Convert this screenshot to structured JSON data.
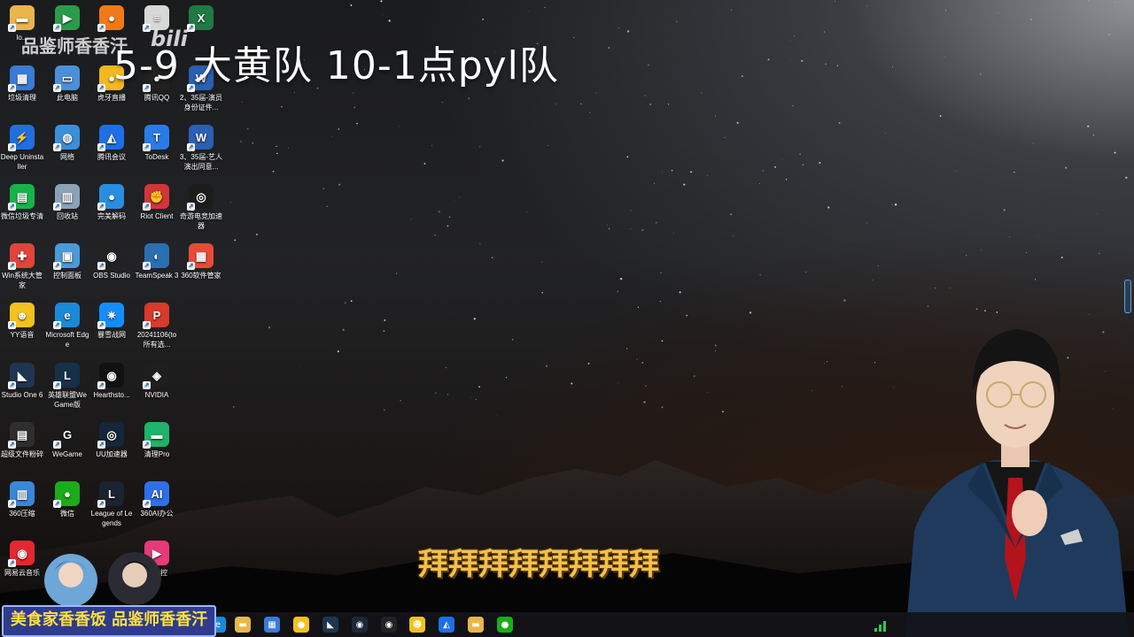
{
  "overlay": {
    "title": "5-9  大黄队  10-1点pyl队",
    "watermark": "品鉴师香香汗",
    "watermark_logo": "bili",
    "subtitle": "拜拜拜拜拜拜拜拜",
    "banner": "美食家香香饭 品鉴师香香汗"
  },
  "desktop_icons": [
    {
      "label": "lo...",
      "icon": "folder-icon",
      "color": "#e8b64a",
      "glyph": "▬"
    },
    {
      "label": "",
      "icon": "play-store-icon",
      "color": "#2b9b4a",
      "glyph": "▶"
    },
    {
      "label": "",
      "icon": "browser-orange-icon",
      "color": "#f07a1a",
      "glyph": "●"
    },
    {
      "label": "",
      "icon": "document-icon",
      "color": "#d8d8d8",
      "glyph": "≡"
    },
    {
      "label": "",
      "icon": "excel-icon",
      "color": "#1f7a43",
      "glyph": "X"
    },
    {
      "label": "垃圾清理",
      "icon": "cleaner-icon",
      "color": "#3a7bd5",
      "glyph": "▦"
    },
    {
      "label": "此电脑",
      "icon": "computer-icon",
      "color": "#4a90d9",
      "glyph": "▭"
    },
    {
      "label": "虎牙直播",
      "icon": "huya-icon",
      "color": "#f3b71f",
      "glyph": "●"
    },
    {
      "label": "腾讯QQ",
      "icon": "qq-icon",
      "color": "#222",
      "glyph": "●"
    },
    {
      "label": "2、35届-演员身份证件...",
      "icon": "word-icon",
      "color": "#2b5fb3",
      "glyph": "W"
    },
    {
      "label": "Deep Uninstaller",
      "icon": "deep-uninstaller-icon",
      "color": "#1f6fe0",
      "glyph": "⚡"
    },
    {
      "label": "网络",
      "icon": "network-icon",
      "color": "#3a8fd9",
      "glyph": "◍"
    },
    {
      "label": "腾讯会议",
      "icon": "tencent-meeting-icon",
      "color": "#1e6fe6",
      "glyph": "◭"
    },
    {
      "label": "ToDesk",
      "icon": "todesk-icon",
      "color": "#2a7be8",
      "glyph": "T"
    },
    {
      "label": "3、35届-艺人演出同意...",
      "icon": "word-icon",
      "color": "#2b5fb3",
      "glyph": "W"
    },
    {
      "label": "微信垃圾专清",
      "icon": "wechat-cleaner-icon",
      "color": "#17b34a",
      "glyph": "▤"
    },
    {
      "label": "回收站",
      "icon": "recycle-bin-icon",
      "color": "#8aa3b8",
      "glyph": "▥"
    },
    {
      "label": "完美解码",
      "icon": "potplayer-icon",
      "color": "#2a8ee0",
      "glyph": "●"
    },
    {
      "label": "Riot Client",
      "icon": "riot-client-icon",
      "color": "#d13639",
      "glyph": "✊"
    },
    {
      "label": "奇游电竞加速器",
      "icon": "qiyou-icon",
      "color": "#1c1c1c",
      "glyph": "◎"
    },
    {
      "label": "Win系统大管家",
      "icon": "win-manager-icon",
      "color": "#e0443a",
      "glyph": "✚"
    },
    {
      "label": "控制面板",
      "icon": "control-panel-icon",
      "color": "#4a9ad9",
      "glyph": "▣"
    },
    {
      "label": "OBS Studio",
      "icon": "obs-icon",
      "color": "#222",
      "glyph": "◉"
    },
    {
      "label": "TeamSpeak 3",
      "icon": "teamspeak-icon",
      "color": "#2a6fb0",
      "glyph": "◐"
    },
    {
      "label": "360软件管家",
      "icon": "360-software-icon",
      "color": "#e84a3a",
      "glyph": "▦"
    },
    {
      "label": "YY语音",
      "icon": "yy-icon",
      "color": "#f3c21f",
      "glyph": "☻"
    },
    {
      "label": "Microsoft Edge",
      "icon": "edge-icon",
      "color": "#1a8ad8",
      "glyph": "e"
    },
    {
      "label": "暴雪战网",
      "icon": "battlenet-icon",
      "color": "#148eff",
      "glyph": "✷"
    },
    {
      "label": "20241106(to所有选...",
      "icon": "pdf-icon",
      "color": "#d93a2a",
      "glyph": "P"
    },
    {
      "label": "",
      "icon": "",
      "color": "",
      "glyph": ""
    },
    {
      "label": "Studio One 6",
      "icon": "studio-one-icon",
      "color": "#1f3650",
      "glyph": "◣"
    },
    {
      "label": "英雄联盟WeGame版",
      "icon": "lol-wegame-icon",
      "color": "#16304a",
      "glyph": "L"
    },
    {
      "label": "Hearthsto...",
      "icon": "hearthstone-icon",
      "color": "#111",
      "glyph": "◉"
    },
    {
      "label": "NVIDIA",
      "icon": "nvidia-icon",
      "color": "#1e1e1e",
      "glyph": "◈"
    },
    {
      "label": "",
      "icon": "",
      "color": "",
      "glyph": ""
    },
    {
      "label": "超级文件粉碎",
      "icon": "file-shredder-icon",
      "color": "#2e2e2e",
      "glyph": "▤"
    },
    {
      "label": "WeGame",
      "icon": "wegame-icon",
      "color": "#1b1b1b",
      "glyph": "G"
    },
    {
      "label": "UU加速器",
      "icon": "uu-icon",
      "color": "#14263a",
      "glyph": "◎"
    },
    {
      "label": "清理Pro",
      "icon": "cleaner-pro-icon",
      "color": "#1fb26a",
      "glyph": "▬"
    },
    {
      "label": "",
      "icon": "",
      "color": "",
      "glyph": ""
    },
    {
      "label": "360压缩",
      "icon": "360-zip-icon",
      "color": "#3a86d8",
      "glyph": "▥"
    },
    {
      "label": "微信",
      "icon": "wechat-icon",
      "color": "#1aad19",
      "glyph": "●"
    },
    {
      "label": "League of Legends",
      "icon": "lol-icon",
      "color": "#1a2330",
      "glyph": "L"
    },
    {
      "label": "360AI办公",
      "icon": "360-ai-icon",
      "color": "#2f6fe8",
      "glyph": "AI"
    },
    {
      "label": "",
      "icon": "",
      "color": "",
      "glyph": ""
    },
    {
      "label": "网易云音乐",
      "icon": "netease-music-icon",
      "color": "#e3282f",
      "glyph": "◉"
    },
    {
      "label": "",
      "icon": "",
      "color": "",
      "glyph": ""
    },
    {
      "label": "",
      "icon": "",
      "color": "",
      "glyph": ""
    },
    {
      "label": "远程控",
      "icon": "remote-control-icon",
      "color": "#e63a7a",
      "glyph": "▶"
    },
    {
      "label": "",
      "icon": "",
      "color": "",
      "glyph": ""
    }
  ],
  "taskbar": [
    {
      "icon": "taskbar-edge-icon",
      "color": "#1a8ad8",
      "glyph": "e"
    },
    {
      "icon": "taskbar-explorer-icon",
      "color": "#e8b64a",
      "glyph": "▬"
    },
    {
      "icon": "taskbar-store-icon",
      "color": "#3a7bd5",
      "glyph": "▦"
    },
    {
      "icon": "taskbar-chat-icon",
      "color": "#f3c21f",
      "glyph": "●"
    },
    {
      "icon": "taskbar-studio-icon",
      "color": "#1f3650",
      "glyph": "◣"
    },
    {
      "icon": "taskbar-steam-icon",
      "color": "#1b2838",
      "glyph": "◉"
    },
    {
      "icon": "taskbar-obs-icon",
      "color": "#222",
      "glyph": "◉"
    },
    {
      "icon": "taskbar-yy-icon",
      "color": "#f3c21f",
      "glyph": "☻"
    },
    {
      "icon": "taskbar-meeting-icon",
      "color": "#1e6fe6",
      "glyph": "◭"
    },
    {
      "icon": "taskbar-folder-icon",
      "color": "#e8b64a",
      "glyph": "▬"
    },
    {
      "icon": "taskbar-wechat-icon",
      "color": "#1aad19",
      "glyph": "●"
    }
  ],
  "colors": {
    "subtitle": "#f3c04a",
    "banner_bg": "#2e3b8f",
    "banner_text": "#ffe040"
  }
}
